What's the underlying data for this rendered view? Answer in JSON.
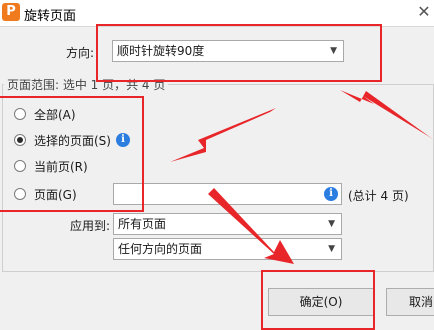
{
  "window": {
    "logo_letter": "P",
    "title": "旋转页面",
    "close_glyph": "✕"
  },
  "direction": {
    "label": "方向:",
    "value": "顺时针旋转90度"
  },
  "page_range": {
    "summary": "页面范围: 选中 1 页，共 4 页",
    "options": [
      {
        "label": "全部(A)",
        "checked": false
      },
      {
        "label": "选择的页面(S)",
        "checked": true
      },
      {
        "label": "当前页(R)",
        "checked": false
      },
      {
        "label": "页面(G)",
        "checked": false
      }
    ],
    "pages_input_value": "",
    "total": "(总计 4 页)"
  },
  "apply_to": {
    "label": "应用到:",
    "value": "所有页面",
    "orientation_value": "任何方向的页面"
  },
  "buttons": {
    "ok": "确定(O)",
    "cancel": "取消"
  },
  "icons": {
    "info": "i",
    "dropdown": "▼"
  },
  "colors": {
    "annotation_red": "#e8262a",
    "info_blue": "#2b7de0",
    "logo_orange": "#f07b1e"
  }
}
